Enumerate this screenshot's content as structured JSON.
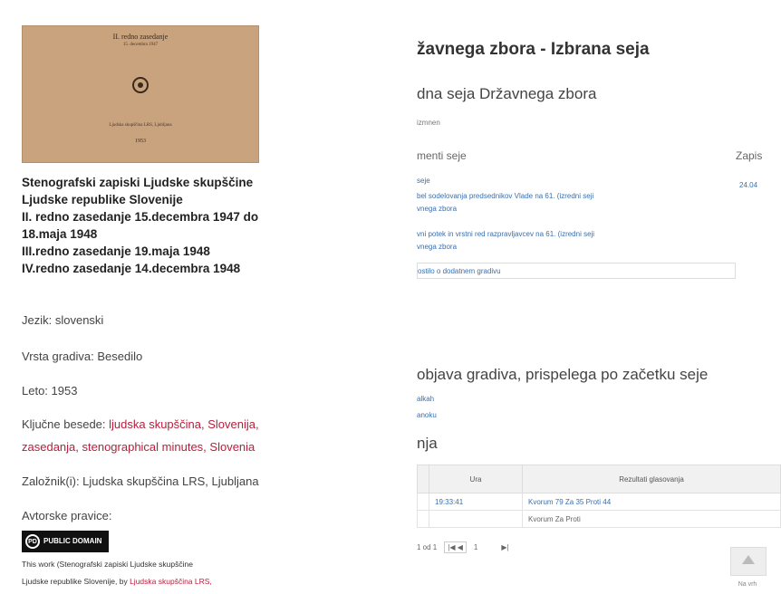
{
  "book": {
    "cover": {
      "line1": "II. redno zasedanje",
      "line2": "15. decembra 1947",
      "line3": "Ljudska skupščina LRS, Ljubljana",
      "line4": "1953"
    },
    "title_lines": [
      "Stenografski zapiski Ljudske skupščine",
      "Ljudske republike Slovenije",
      "II. redno zasedanje 15.decembra 1947 do",
      "18.maja 1948",
      "III.redno zasedanje 19.maja 1948",
      "IV.redno zasedanje 14.decembra 1948"
    ],
    "language": "Jezik: slovenski",
    "material_type": "Vrsta gradiva: Besedilo",
    "year": "Leto: 1953",
    "keywords_label": "Ključne besede: ",
    "keywords_line1": "ljudska skupščina, Slovenija,",
    "keywords_line2": "zasedanja, stenographical minutes, Slovenia",
    "publisher": "Založnik(i): Ljudska skupščina LRS, Ljubljana",
    "rights_label": "Avtorske pravice:",
    "license_badge": "PUBLIC DOMAIN",
    "license_text_line1": "This work (Stenografski zapiski Ljudske skupščine",
    "license_text_line2_a": "Ljudske republike Slovenije, by ",
    "license_text_line2_b": "Ljudska skupščina LRS,"
  },
  "session": {
    "heading": "žavnega zbora - Izbrana seja",
    "subheading": "dna seja Državnega zbora",
    "small_label": "izmnen",
    "documents_label": "menti seje",
    "records_label": "Zapis",
    "record_date": "24.04",
    "doc_links": [
      "seje",
      "bel sodelovanja predsednikov Vlade na 61. (izredni seji",
      "vnega zbora",
      "vni potek in vrstni red razpravljavcev na 61. (izredni seji",
      "vnega zbora",
      "ostilo o dodatnem gradivu"
    ],
    "publication_heading": "objava gradiva, prispelega po začetku seje",
    "publication_links": [
      "alkah",
      "anoku"
    ],
    "votes_heading": "nja",
    "votes_table": {
      "headers": [
        "Ura",
        "Rezultati glasovanja"
      ],
      "rows": [
        {
          "time": "19:33:41",
          "result": "Kvorum 79 Za 35 Proti 44"
        },
        {
          "time": "",
          "result": "Kvorum Za Proti"
        }
      ]
    },
    "pager": {
      "info": "1 od 1",
      "nav": "|◀ ◀",
      "page": "1",
      "next": "▶|"
    },
    "scroll_up_label": "Na vrh"
  }
}
